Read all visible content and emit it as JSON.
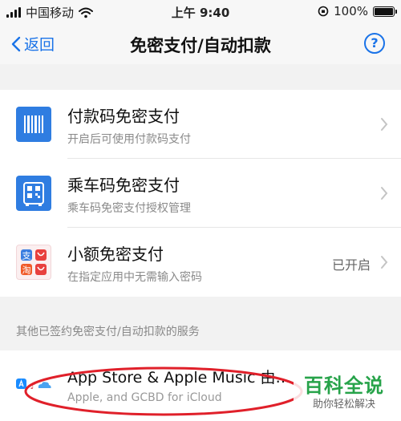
{
  "status_bar": {
    "carrier": "中国移动",
    "time": "上午 9:40",
    "battery": "100%"
  },
  "nav": {
    "back_label": "返回",
    "title": "免密支付/自动扣款",
    "help_label": "?"
  },
  "services": [
    {
      "title": "付款码免密支付",
      "subtitle": "开启后可使用付款码支付",
      "status": "",
      "icon": "barcode-icon"
    },
    {
      "title": "乘车码免密支付",
      "subtitle": "乘车码免密支付授权管理",
      "status": "",
      "icon": "bus-qr-icon"
    },
    {
      "title": "小额免密支付",
      "subtitle": "在指定应用中无需输入密码",
      "status": "已开启",
      "icon": "app-grid-icon"
    }
  ],
  "other_section": {
    "header": "其他已签约免密支付/自动扣款的服务",
    "items": [
      {
        "title": "App Store & Apple Music 由…",
        "subtitle": "Apple, and GCBD for iCloud",
        "icon": "app-store-icon"
      }
    ]
  },
  "watermark": {
    "title": "百科全说",
    "subtitle": "助你轻松解决"
  },
  "colors": {
    "accent": "#1a73e8",
    "icon_blue": "#2f7de1",
    "annotation_red": "#e0202a",
    "watermark_green": "#27a34a"
  }
}
